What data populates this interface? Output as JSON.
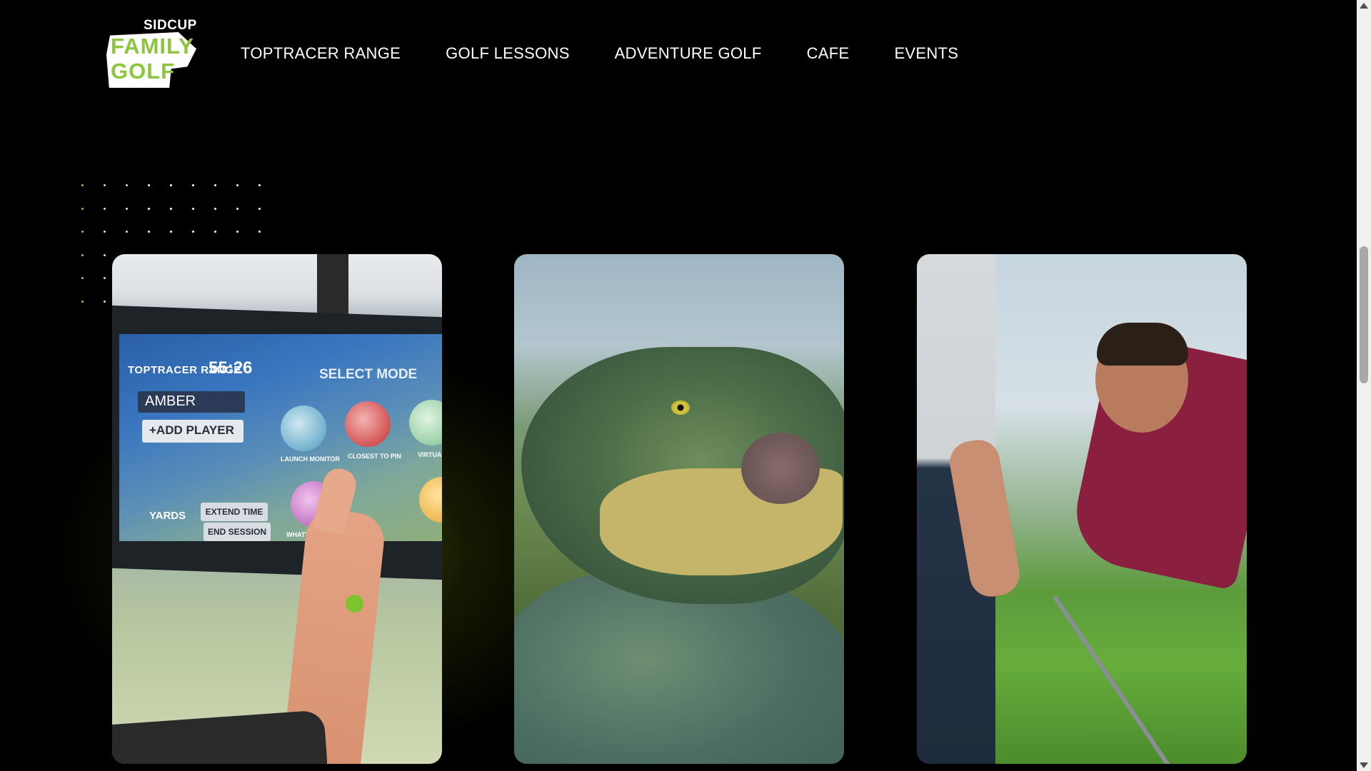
{
  "header": {
    "logo": {
      "top_word": "SIDCUP",
      "line1": "FAMILY",
      "line2": "GOLF"
    },
    "nav": [
      {
        "label": "TOPTRACER RANGE"
      },
      {
        "label": "GOLF LESSONS"
      },
      {
        "label": "ADVENTURE GOLF"
      },
      {
        "label": "CAFE"
      },
      {
        "label": "EVENTS"
      }
    ]
  },
  "colors": {
    "accent": "#8cc63f",
    "background": "#000000",
    "dot_green": "#7dc22f"
  },
  "cards": [
    {
      "name": "toptracer-photo",
      "screen": {
        "brand": "TOPTRACER RANGE",
        "time": "55:26",
        "mode_title": "SELECT MODE",
        "player": "AMBER",
        "add_player": "+ADD PLAYER",
        "units": "YARDS",
        "extend": "EXTEND TIME",
        "end": "END SESSION",
        "captions": [
          "LAUNCH MONITOR",
          "CLOSEST TO PIN",
          "VIRTUAL",
          "WHAT'S IN MY"
        ]
      }
    },
    {
      "name": "dinosaur-photo"
    },
    {
      "name": "golf-lesson-photo"
    }
  ]
}
